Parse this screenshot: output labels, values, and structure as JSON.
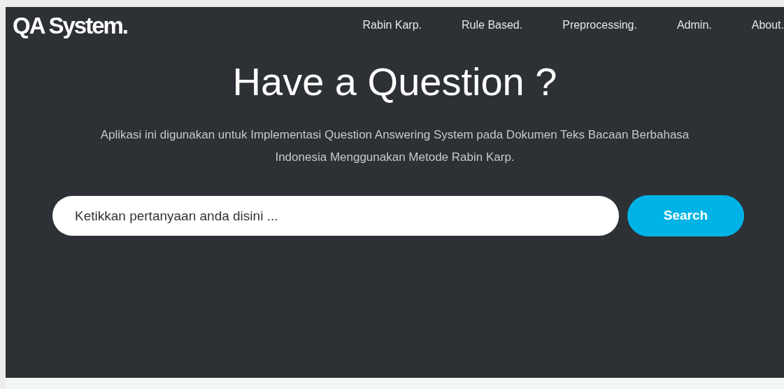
{
  "brand": "QA System.",
  "nav": [
    {
      "label": "Rabin Karp."
    },
    {
      "label": "Rule Based."
    },
    {
      "label": "Preprocessing."
    },
    {
      "label": "Admin."
    },
    {
      "label": "About."
    }
  ],
  "hero": {
    "title": "Have a Question ?",
    "description": "Aplikasi ini digunakan untuk Implementasi Question Answering System pada Dokumen Teks Bacaan Berbahasa Indonesia Menggunakan Metode Rabin Karp."
  },
  "search": {
    "placeholder": "Ketikkan pertanyaan anda disini ...",
    "button": "Search"
  }
}
